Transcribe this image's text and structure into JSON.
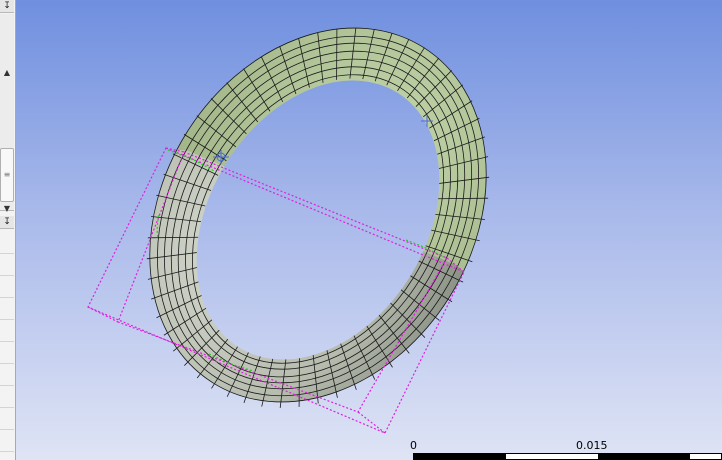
{
  "left_panel": {
    "pin_icon_top": "↧",
    "pin_icon_bottom": "↧",
    "scroll_up_icon": "▲",
    "scroll_thumb_icon": "≡",
    "scroll_down_icon": "▼"
  },
  "viewport": {
    "background_top": "#6f8fdf",
    "background_bottom": "#dfe4f5",
    "selected_face_color": "#b2c898",
    "body_color": "#bcc2b6",
    "mesh_line_color": "#1a1a1a",
    "bounding_box_color": "#dd22dd",
    "edge_highlight_color": "#22cc22"
  },
  "scale_bar": {
    "label_start": "0",
    "label_mid": "0.015"
  }
}
